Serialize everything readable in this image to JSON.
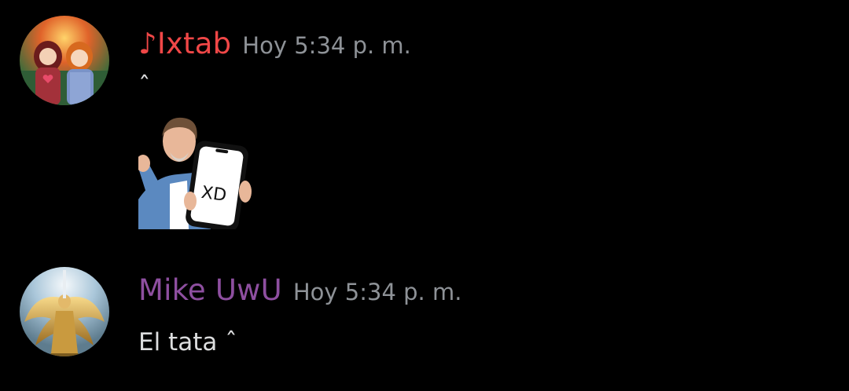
{
  "messages": [
    {
      "username": "♪Ixtab",
      "username_color": "#f04747",
      "timestamp": "Hoy 5:34 p. m.",
      "content": "ˆ",
      "attachment": {
        "type": "sticker-image",
        "phone_text": "XD"
      }
    },
    {
      "username": "Mike UwU",
      "username_color": "#8e4fa0",
      "timestamp": "Hoy 5:34 p. m.",
      "content": "El tata ˆ"
    }
  ],
  "colors": {
    "background": "#000000",
    "timestamp": "#8e9297",
    "text": "#dcddde"
  }
}
